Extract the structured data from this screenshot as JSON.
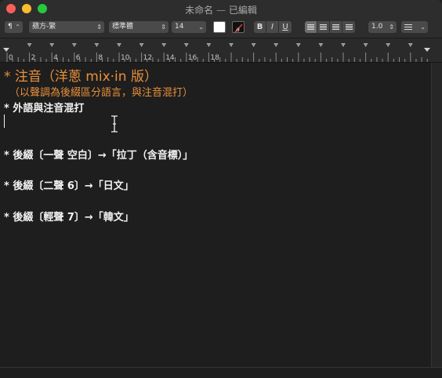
{
  "window": {
    "title": "未命名",
    "title_separator": " — ",
    "title_status": "已編輯"
  },
  "toolbar": {
    "paragraph_style": "¶",
    "font_family": "蘋方-繁",
    "font_style": "標準體",
    "font_size": "14",
    "bold": "B",
    "italic": "I",
    "underline": "U",
    "line_spacing": "1.0",
    "text_color": "#ffffff",
    "highlight_color": "#000000"
  },
  "ruler": {
    "labels": [
      "0",
      "2",
      "4",
      "6",
      "8",
      "10",
      "12",
      "14",
      "16",
      "18"
    ]
  },
  "document": {
    "heading": "* 注音（洋蔥 mix·in 版）",
    "subheading": "（以聲調為後綴區分語言，與注音混打）",
    "line1": "* 外語與注音混打",
    "line2": "* 後綴〔一聲 空白〕→「拉丁（含音標）」",
    "line3": "* 後綴〔二聲 6〕→「日文」",
    "line4": "* 後綴〔輕聲 7〕→「韓文」"
  },
  "colors": {
    "heading": "#e8903a",
    "body_text": "#f2f2f2",
    "background": "#1e1e1e"
  }
}
